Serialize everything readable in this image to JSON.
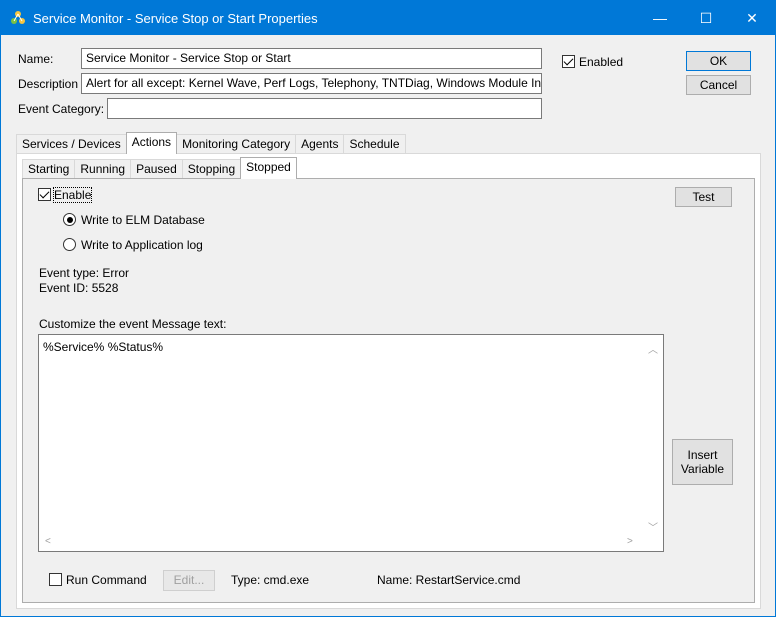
{
  "window": {
    "title": "Service Monitor - Service Stop or Start Properties",
    "controls": {
      "minimize": "—",
      "maximize": "☐",
      "close": "✕"
    }
  },
  "form": {
    "name_label": "Name:",
    "name_value": "Service Monitor - Service Stop or Start",
    "description_label": "Description",
    "description_value": "Alert for all except: Kernel Wave, Perf Logs, Telephony, TNTDiag, Windows Module In",
    "event_category_label": "Event Category:",
    "event_category_value": "",
    "enabled_label": "Enabled",
    "enabled_checked": true
  },
  "buttons": {
    "ok": "OK",
    "cancel": "Cancel",
    "test": "Test",
    "insert_variable_line1": "Insert",
    "insert_variable_line2": "Variable",
    "edit": "Edit..."
  },
  "main_tabs": [
    "Services / Devices",
    "Actions",
    "Monitoring Category",
    "Agents",
    "Schedule"
  ],
  "main_tab_active": "Actions",
  "sub_tabs": [
    "Starting",
    "Running",
    "Paused",
    "Stopping",
    "Stopped"
  ],
  "sub_tab_active": "Stopped",
  "stopped_panel": {
    "enable_label": "Enable",
    "enable_checked": true,
    "radio_elm": "Write to ELM Database",
    "radio_app_log": "Write to Application log",
    "selected_radio": "Write to ELM Database",
    "event_type": "Event type: Error",
    "event_id": "Event ID: 5528",
    "customize_label": "Customize the event Message text:",
    "message_text": "%Service% %Status%",
    "run_command_label": "Run Command",
    "run_command_checked": false,
    "type_text": "Type: cmd.exe",
    "name_text": "Name: RestartService.cmd"
  }
}
